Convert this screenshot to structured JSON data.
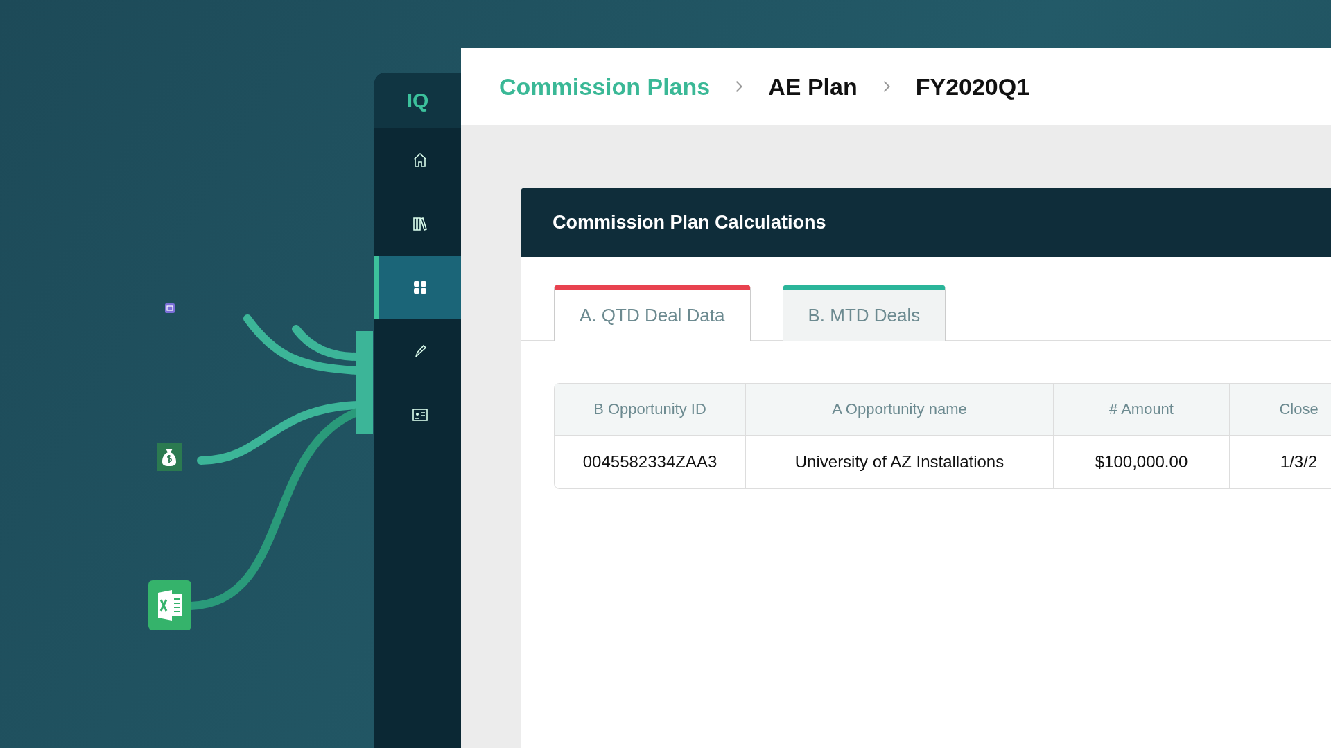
{
  "sidebar": {
    "logo": "IQ",
    "items": [
      {
        "kind": "home",
        "selected": false
      },
      {
        "kind": "library",
        "selected": false
      },
      {
        "kind": "grid",
        "selected": true
      },
      {
        "kind": "pen",
        "selected": false
      },
      {
        "kind": "card",
        "selected": false
      }
    ]
  },
  "breadcrumb": [
    {
      "label": "Commission Plans",
      "kind": "link"
    },
    {
      "label": "AE Plan",
      "kind": "plain"
    },
    {
      "label": "FY2020Q1",
      "kind": "plain"
    }
  ],
  "card": {
    "title": "Commission Plan Calculations"
  },
  "tabs": [
    {
      "label": "A. QTD Deal Data",
      "selected": true,
      "color": "#e8424f"
    },
    {
      "label": "B. MTD Deals",
      "selected": false,
      "color": "#2bb59a"
    }
  ],
  "table": {
    "columns": [
      "B Opportunity ID",
      "A Opportunity name",
      "# Amount",
      "Close"
    ],
    "rows": [
      [
        "0045582334ZAA3",
        "University of AZ Installations",
        "$100,000.00",
        "1/3/2"
      ]
    ]
  }
}
